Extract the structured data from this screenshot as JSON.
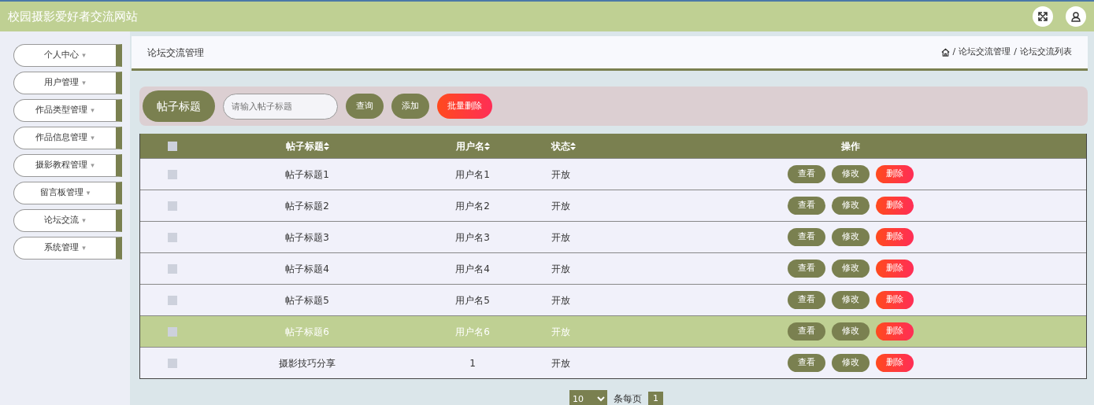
{
  "header": {
    "title": "校园摄影爱好者交流网站"
  },
  "sidebar": {
    "items": [
      {
        "label": "个人中心",
        "caret": "▾"
      },
      {
        "label": "用户管理",
        "caret": "▾"
      },
      {
        "label": "作品类型管理",
        "caret": "▾"
      },
      {
        "label": "作品信息管理",
        "caret": "▾"
      },
      {
        "label": "摄影教程管理",
        "caret": "▾"
      },
      {
        "label": "留言板管理",
        "caret": "▾"
      },
      {
        "label": "论坛交流",
        "caret": "▾"
      },
      {
        "label": "系统管理",
        "caret": "▾"
      }
    ]
  },
  "page_title": "论坛交流管理",
  "breadcrumb": [
    {
      "separator": "/",
      "label": "论坛交流管理"
    },
    {
      "separator": "/",
      "label": "论坛交流列表"
    }
  ],
  "search": {
    "label": "帖子标题",
    "placeholder": "请输入帖子标题",
    "buttons": [
      {
        "label": "查询",
        "kind": "normal"
      },
      {
        "label": "添加",
        "kind": "normal"
      },
      {
        "label": "批量删除",
        "kind": "danger"
      }
    ]
  },
  "table": {
    "select_all_checked": false,
    "columns": [
      {
        "label": "帖子标题",
        "sortable": true
      },
      {
        "label": "用户名",
        "sortable": true
      },
      {
        "label": "状态",
        "sortable": true
      },
      {
        "label": "操作",
        "sortable": false
      }
    ],
    "rows": [
      {
        "title": "帖子标题1",
        "user": "用户名1",
        "status": "开放",
        "highlighted": false,
        "checked": false,
        "actions": [
          {
            "label": "查看",
            "kind": "normal"
          },
          {
            "label": "修改",
            "kind": "normal"
          },
          {
            "label": "删除",
            "kind": "danger"
          }
        ]
      },
      {
        "title": "帖子标题2",
        "user": "用户名2",
        "status": "开放",
        "highlighted": false,
        "checked": false,
        "actions": [
          {
            "label": "查看",
            "kind": "normal"
          },
          {
            "label": "修改",
            "kind": "normal"
          },
          {
            "label": "删除",
            "kind": "danger"
          }
        ]
      },
      {
        "title": "帖子标题3",
        "user": "用户名3",
        "status": "开放",
        "highlighted": false,
        "checked": false,
        "actions": [
          {
            "label": "查看",
            "kind": "normal"
          },
          {
            "label": "修改",
            "kind": "normal"
          },
          {
            "label": "删除",
            "kind": "danger"
          }
        ]
      },
      {
        "title": "帖子标题4",
        "user": "用户名4",
        "status": "开放",
        "highlighted": false,
        "checked": false,
        "actions": [
          {
            "label": "查看",
            "kind": "normal"
          },
          {
            "label": "修改",
            "kind": "normal"
          },
          {
            "label": "删除",
            "kind": "danger"
          }
        ]
      },
      {
        "title": "帖子标题5",
        "user": "用户名5",
        "status": "开放",
        "highlighted": false,
        "checked": false,
        "actions": [
          {
            "label": "查看",
            "kind": "normal"
          },
          {
            "label": "修改",
            "kind": "normal"
          },
          {
            "label": "删除",
            "kind": "danger"
          }
        ]
      },
      {
        "title": "帖子标题6",
        "user": "用户名6",
        "status": "开放",
        "highlighted": true,
        "checked": false,
        "actions": [
          {
            "label": "查看",
            "kind": "normal"
          },
          {
            "label": "修改",
            "kind": "normal"
          },
          {
            "label": "删除",
            "kind": "danger"
          }
        ]
      },
      {
        "title": "摄影技巧分享",
        "user": "1",
        "status": "开放",
        "highlighted": false,
        "checked": false,
        "actions": [
          {
            "label": "查看",
            "kind": "normal"
          },
          {
            "label": "修改",
            "kind": "normal"
          },
          {
            "label": "删除",
            "kind": "danger"
          }
        ]
      }
    ]
  },
  "pagination": {
    "page_size": "10",
    "per_page_label": "条每页",
    "pages": [
      {
        "label": "1",
        "selected": true
      }
    ]
  }
}
